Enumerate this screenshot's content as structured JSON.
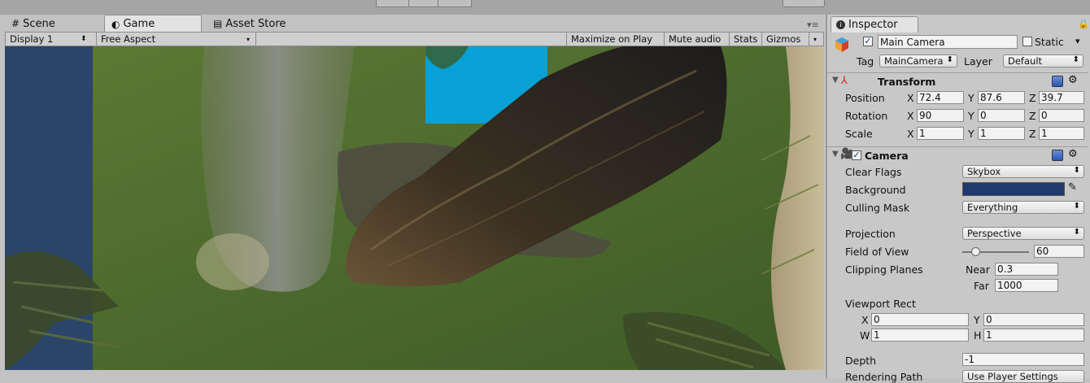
{
  "tabs": [
    {
      "label": "Scene",
      "icon": "grid-icon"
    },
    {
      "label": "Game",
      "icon": "game-icon"
    },
    {
      "label": "Asset Store",
      "icon": "store-icon"
    }
  ],
  "game_toolbar": {
    "display": "Display 1",
    "aspect": "Free Aspect",
    "maximize": "Maximize on Play",
    "mute": "Mute audio",
    "stats": "Stats",
    "gizmos": "Gizmos"
  },
  "inspector": {
    "tab_label": "Inspector",
    "object_name": "Main Camera",
    "static_label": "Static",
    "tag_label": "Tag",
    "tag_value": "MainCamera",
    "layer_label": "Layer",
    "layer_value": "Default",
    "transform": {
      "title": "Transform",
      "position_label": "Position",
      "position": {
        "x": "72.4",
        "y": "87.6",
        "z": "39.7"
      },
      "rotation_label": "Rotation",
      "rotation": {
        "x": "90",
        "y": "0",
        "z": "0"
      },
      "scale_label": "Scale",
      "scale": {
        "x": "1",
        "y": "1",
        "z": "1"
      },
      "axis_x": "X",
      "axis_y": "Y",
      "axis_z": "Z"
    },
    "camera": {
      "title": "Camera",
      "clear_flags_label": "Clear Flags",
      "clear_flags": "Skybox",
      "background_label": "Background",
      "background_color": "#1f3a6b",
      "culling_mask_label": "Culling Mask",
      "culling_mask": "Everything",
      "projection_label": "Projection",
      "projection": "Perspective",
      "fov_label": "Field of View",
      "fov": "60",
      "fov_fraction": 0.2,
      "clipping_label": "Clipping Planes",
      "near_label": "Near",
      "near": "0.3",
      "far_label": "Far",
      "far": "1000",
      "viewport_label": "Viewport Rect",
      "vx_label": "X",
      "vx": "0",
      "vy_label": "Y",
      "vy": "0",
      "vw_label": "W",
      "vw": "1",
      "vh_label": "H",
      "vh": "1",
      "depth_label": "Depth",
      "depth": "-1",
      "rendering_path_label": "Rendering Path",
      "rendering_path": "Use Player Settings"
    }
  },
  "colors": {
    "sky": "#07a1d6",
    "water": "#2b4568",
    "grass": "#4d6a2e",
    "accent": "#2f6fd6"
  }
}
